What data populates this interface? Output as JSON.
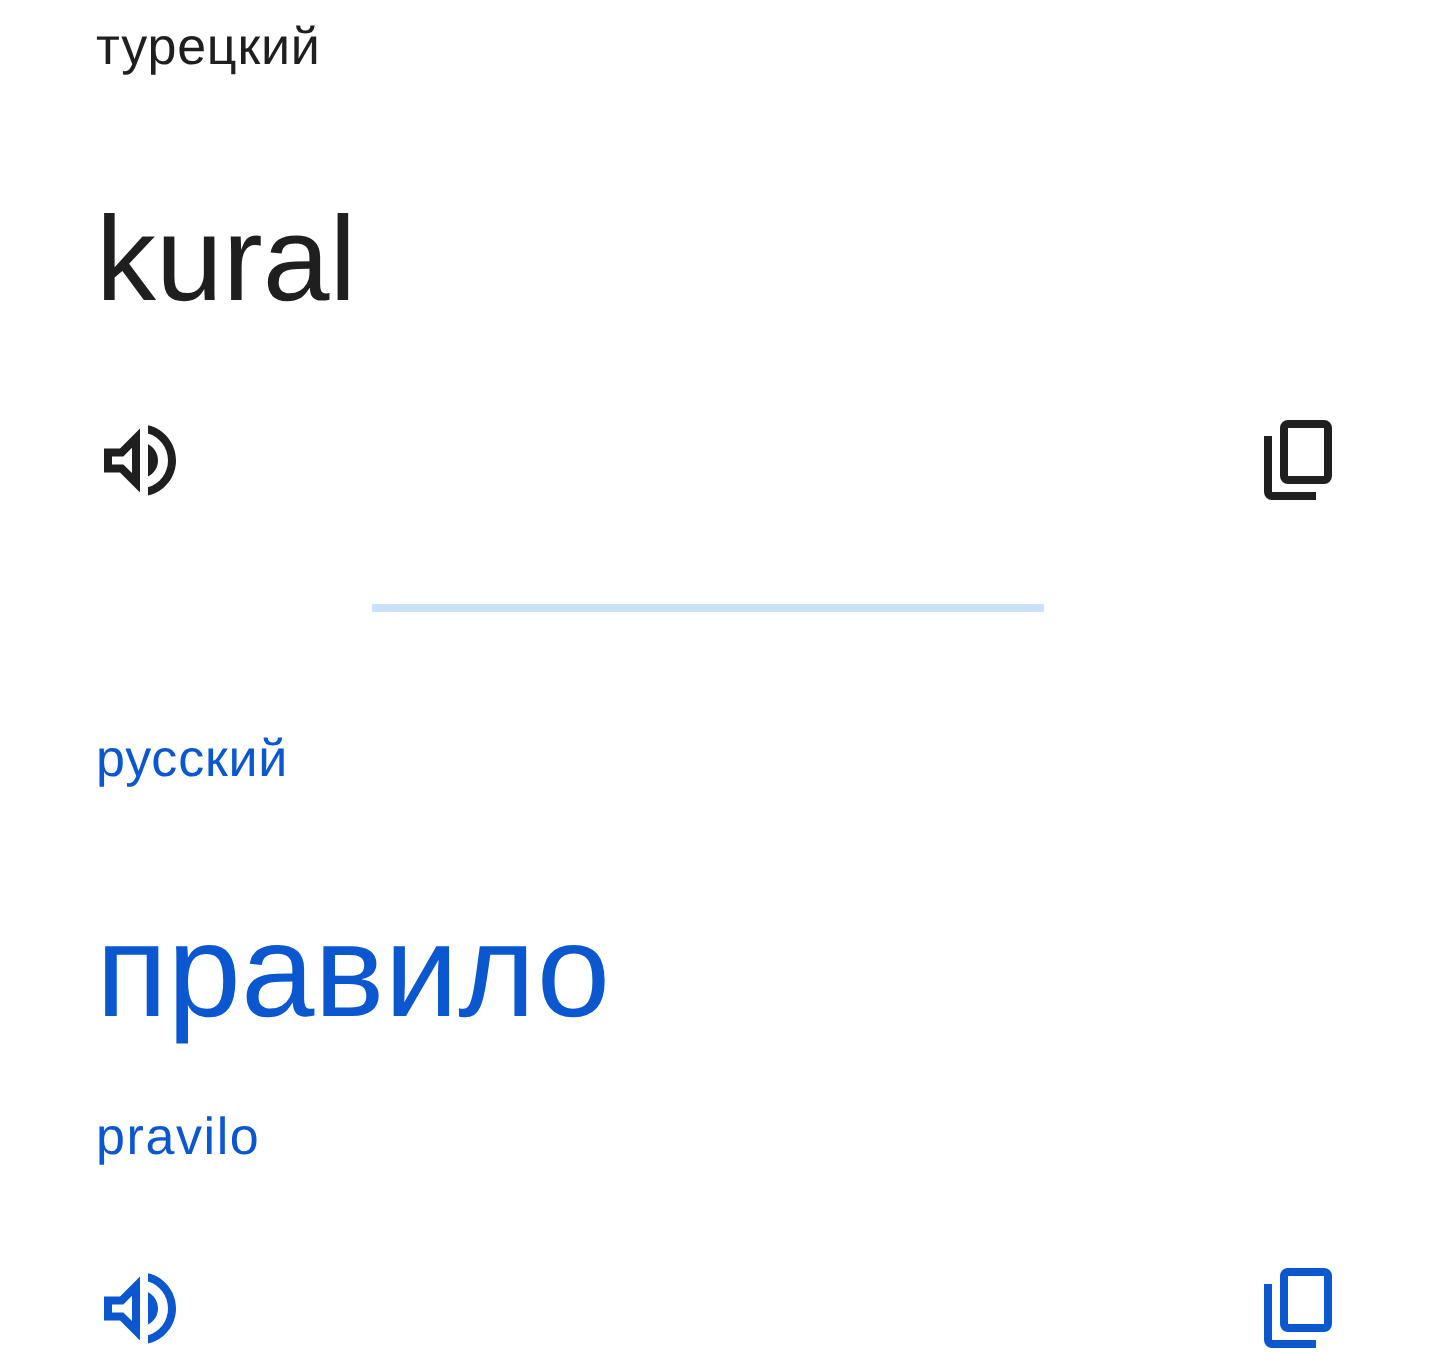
{
  "panels": [
    {
      "kind": "source",
      "language": "турецкий",
      "text": "kural"
    },
    {
      "kind": "target",
      "language": "русский",
      "text": "правило",
      "transliteration": "pravilo"
    }
  ]
}
